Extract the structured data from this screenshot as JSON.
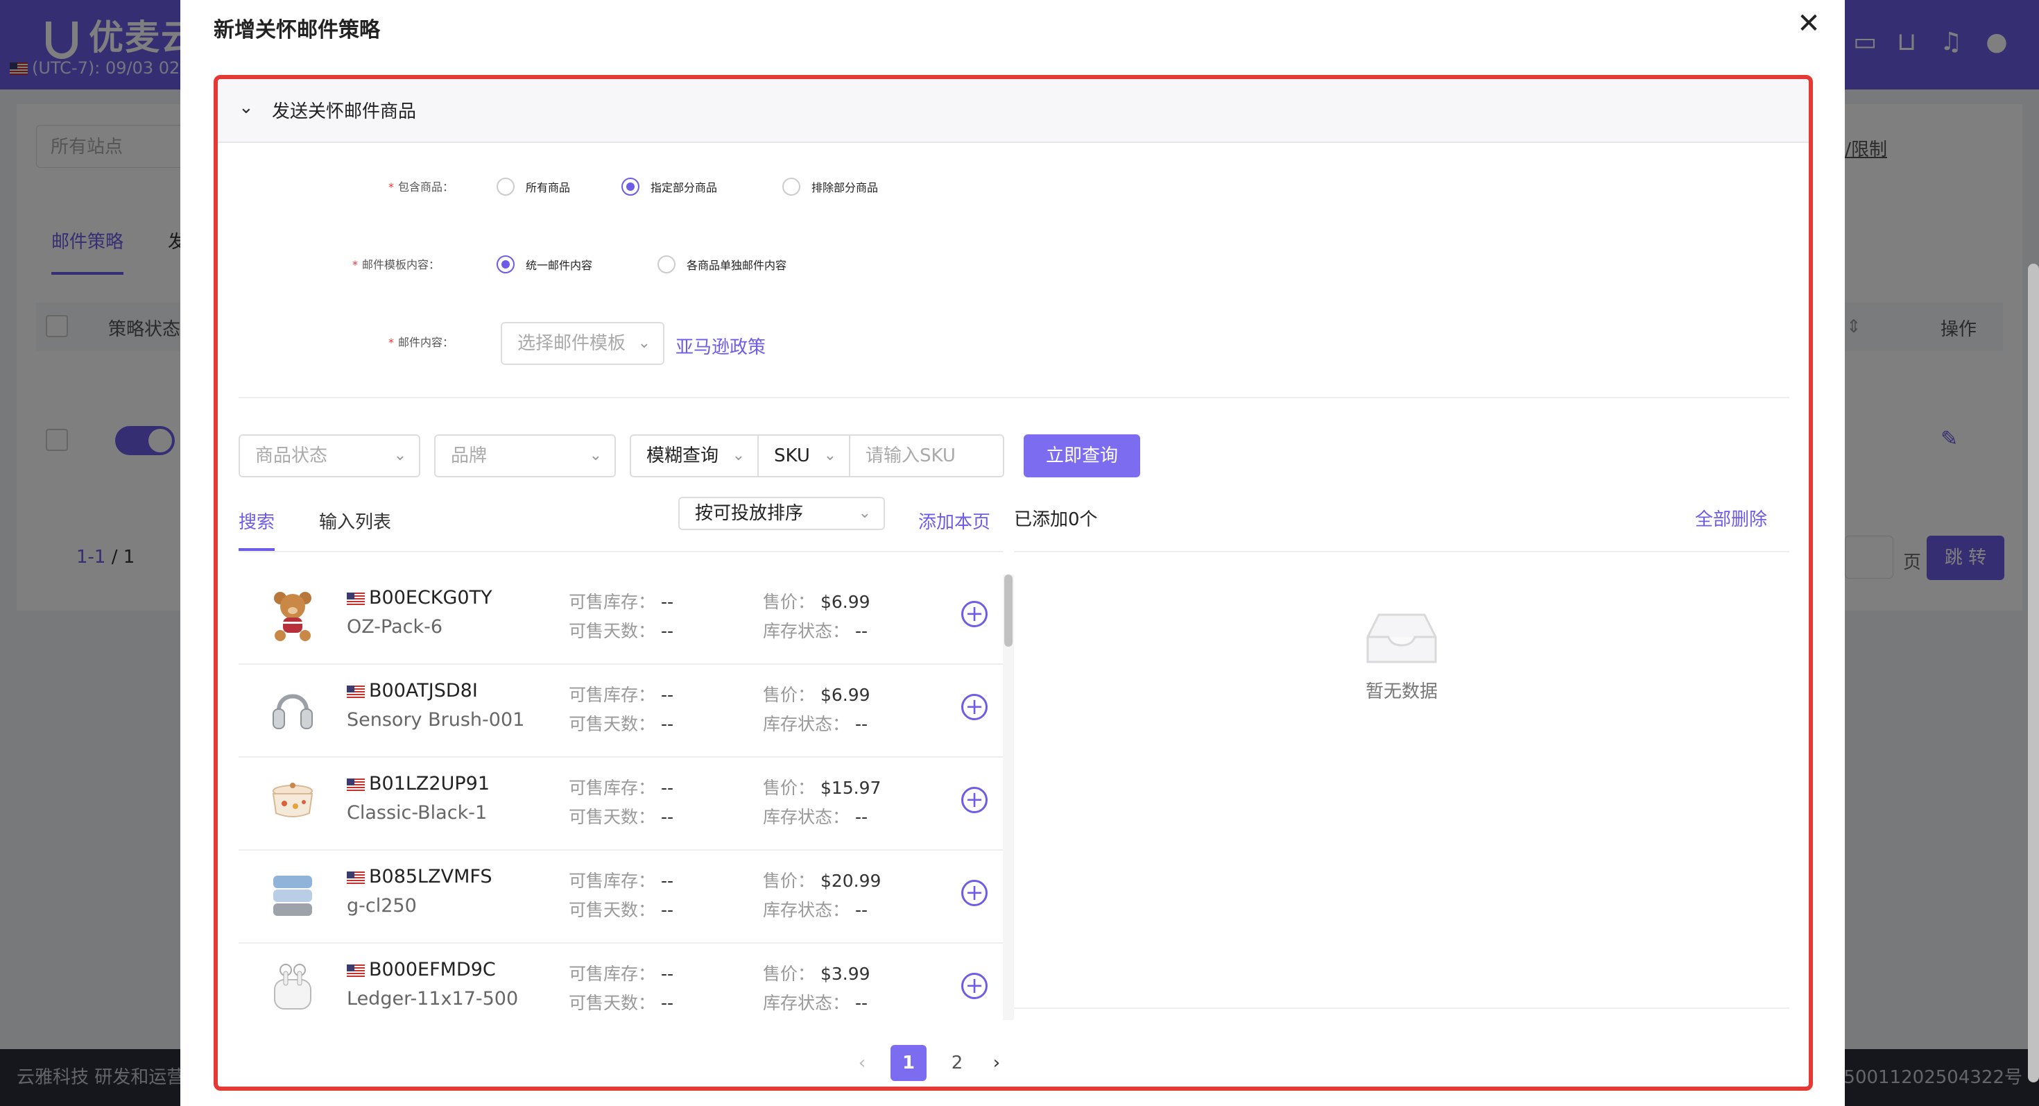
{
  "app": {
    "logo_text": "优麦云",
    "timezone_text": "(UTC-7): 09/03 02",
    "site_select_placeholder": "所有站点",
    "tabs": [
      "邮件策略",
      "发"
    ],
    "table_headers": {
      "status": "策略状态",
      "operation": "操作"
    },
    "pager_text": "1-1",
    "pager_total": "/ 1",
    "right_link_text": "t/限制",
    "jump_label": "页",
    "jump_button": "跳 转",
    "footer_left": "云雅科技 研发和运营",
    "footer_right": "50011202504322号"
  },
  "modal": {
    "title": "新增关怀邮件策略",
    "section_title": "发送关怀邮件商品",
    "include_label": "包含商品：",
    "include_options": [
      {
        "label": "所有商品",
        "selected": false
      },
      {
        "label": "指定部分商品",
        "selected": true
      },
      {
        "label": "排除部分商品",
        "selected": false
      }
    ],
    "template_label": "邮件模板内容：",
    "template_options": [
      {
        "label": "统一邮件内容",
        "selected": true
      },
      {
        "label": "各商品单独邮件内容",
        "selected": false
      }
    ],
    "content_label": "邮件内容：",
    "content_select_placeholder": "选择邮件模板",
    "policy_link": "亚马逊政策",
    "filters": {
      "status_placeholder": "商品状态",
      "brand_placeholder": "品牌",
      "match_mode": "模糊查询",
      "field": "SKU",
      "sku_placeholder": "请输入SKU",
      "search_button": "立即查询"
    },
    "list_tabs": [
      "搜索",
      "输入列表"
    ],
    "sort_select": "按可投放排序",
    "add_page_link": "添加本页",
    "added_count": "已添加0个",
    "delete_all_link": "全部删除",
    "empty_text": "暂无数据",
    "labels": {
      "stock": "可售库存：",
      "days": "可售天数：",
      "price": "售价：",
      "stock_status": "库存状态："
    },
    "products": [
      {
        "asin": "B00ECKG0TY",
        "sku": "OZ-Pack-6",
        "stock": "--",
        "days": "--",
        "price": "$6.99",
        "stock_status": "--",
        "icon": "teddy-bear"
      },
      {
        "asin": "B00ATJSD8I",
        "sku": "Sensory Brush-001",
        "stock": "--",
        "days": "--",
        "price": "$6.99",
        "stock_status": "--",
        "icon": "headphones"
      },
      {
        "asin": "B01LZ2UP91",
        "sku": "Classic-Black-1",
        "stock": "--",
        "days": "--",
        "price": "$15.97",
        "stock_status": "--",
        "icon": "casserole-pot"
      },
      {
        "asin": "B085LZVMFS",
        "sku": "g-cl250",
        "stock": "--",
        "days": "--",
        "price": "$20.99",
        "stock_status": "--",
        "icon": "towels"
      },
      {
        "asin": "B000EFMD9C",
        "sku": "Ledger-11x17-500",
        "stock": "--",
        "days": "--",
        "price": "$3.99",
        "stock_status": "--",
        "icon": "earbuds"
      }
    ],
    "pagination": {
      "prev": "‹",
      "pages": [
        "1",
        "2"
      ],
      "current": "1",
      "next": "›"
    }
  },
  "colors": {
    "accent": "#6d5ce7",
    "highlight_border": "#e53935"
  }
}
